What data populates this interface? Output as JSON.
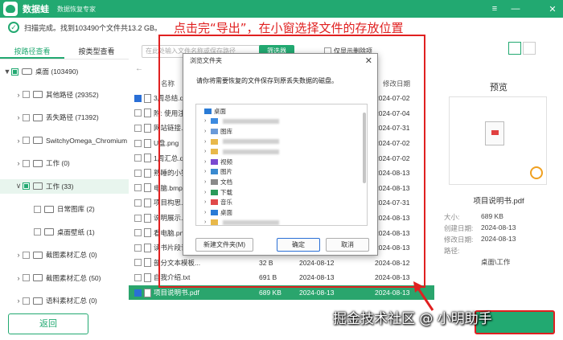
{
  "app": {
    "name": "数据蛙",
    "subtitle": "数据恢复专家"
  },
  "status": {
    "text": "扫描完成。找到103490个文件共13.2 GB。"
  },
  "annotation": {
    "instruction": "点击完“导出”，在小窗选择文件的存放位置",
    "watermark": "掘金技术社区 @ 小明助手"
  },
  "sidebar": {
    "tabs": [
      {
        "label": "按路径查看",
        "active": true
      },
      {
        "label": "按类型查看",
        "active": false
      }
    ],
    "tree": [
      {
        "label": "桌面 (103490)",
        "indent": 0,
        "arrow": "▼",
        "state": "part",
        "icon": "drive"
      },
      {
        "label": "其他路径 (29352)",
        "indent": 1,
        "arrow": "›",
        "state": "",
        "icon": "folder"
      },
      {
        "label": "丢失路径 (71392)",
        "indent": 1,
        "arrow": "›",
        "state": "",
        "icon": "folder"
      },
      {
        "label": "SwitchyOmega_Chromium",
        "indent": 1,
        "arrow": "›",
        "state": "",
        "icon": "folder"
      },
      {
        "label": "工作 (0)",
        "indent": 1,
        "arrow": "›",
        "state": "",
        "icon": "folder"
      },
      {
        "label": "工作 (33)",
        "indent": 1,
        "arrow": "∨",
        "state": "part",
        "icon": "folder",
        "selected": true
      },
      {
        "label": "日常图库 (2)",
        "indent": 2,
        "arrow": "",
        "state": "",
        "icon": "folder"
      },
      {
        "label": "桌面壁纸 (1)",
        "indent": 2,
        "arrow": "",
        "state": "",
        "icon": "folder"
      },
      {
        "label": "截图素材汇总 (0)",
        "indent": 1,
        "arrow": "›",
        "state": "",
        "icon": "folder"
      },
      {
        "label": "截图素材汇总 (50)",
        "indent": 1,
        "arrow": "›",
        "state": "",
        "icon": "folder"
      },
      {
        "label": "语料素材汇总 (0)",
        "indent": 1,
        "arrow": "›",
        "state": "",
        "icon": "folder"
      }
    ],
    "back_label": "返回"
  },
  "toolbar": {
    "search_placeholder": "在此处输入文件名称或保存路径",
    "filter_label": "筛选器",
    "only_deleted_label": "仅显示删除项"
  },
  "files": {
    "headers": {
      "name": "名称",
      "date": "修改日期"
    },
    "rows": [
      {
        "name": "3周总结.do",
        "size": "",
        "extra": "",
        "date": "2024-07-02",
        "checked": true
      },
      {
        "name": "附: 使用注",
        "size": "",
        "extra": "",
        "date": "2024-07-04",
        "checked": false
      },
      {
        "name": "网站链接.tx",
        "size": "",
        "extra": "",
        "date": "2024-07-31",
        "checked": false
      },
      {
        "name": "U盘.png",
        "size": "",
        "extra": "",
        "date": "2024-07-02",
        "checked": false
      },
      {
        "name": "1周汇总.do",
        "size": "",
        "extra": "",
        "date": "2024-07-02",
        "checked": false
      },
      {
        "name": "熟睡的小猫",
        "size": "",
        "extra": "",
        "date": "2024-08-13",
        "checked": false
      },
      {
        "name": "电脑.bmp",
        "size": "",
        "extra": "",
        "date": "2024-08-13",
        "checked": false
      },
      {
        "name": "项目构思.d",
        "size": "",
        "extra": "",
        "date": "2024-07-31",
        "checked": false
      },
      {
        "name": "说明展示.p",
        "size": "",
        "extra": "",
        "date": "2024-08-13",
        "checked": false
      },
      {
        "name": "看电脑.png",
        "size": "",
        "extra": "",
        "date": "2024-08-13",
        "checked": false
      },
      {
        "name": "读书片段记",
        "size": "",
        "extra": "",
        "date": "2024-08-13",
        "checked": false
      },
      {
        "name": "部分文本模板...",
        "size": "32 B",
        "extra": "2024-08-12",
        "date": "2024-08-12",
        "checked": false
      },
      {
        "name": "自我介绍.txt",
        "size": "691 B",
        "extra": "2024-08-13",
        "date": "2024-08-13",
        "checked": false
      },
      {
        "name": "项目说明书.pdf",
        "size": "689 KB",
        "extra": "2024-08-13",
        "date": "2024-08-13",
        "checked": true,
        "selected": true
      }
    ]
  },
  "preview": {
    "title": "预览",
    "filename": "项目说明书.pdf",
    "meta": [
      {
        "label": "大小:",
        "value": "689 KB"
      },
      {
        "label": "创建日期:",
        "value": "2024-08-13"
      },
      {
        "label": "修改日期:",
        "value": "2024-08-13"
      },
      {
        "label": "路径:",
        "value": ""
      },
      {
        "label": "",
        "value": "桌面\\工作"
      }
    ]
  },
  "dialog": {
    "title": "浏览文件夹",
    "message": "请你将需要恢复的文件保存到原丢失数据的磁盘。",
    "tree": [
      {
        "label": "桌面",
        "indent": 0,
        "arrow": "",
        "icon": "#2a7bd6"
      },
      {
        "label": "",
        "indent": 1,
        "arrow": "›",
        "icon": "#3c8ae0",
        "blur": true
      },
      {
        "label": "图库",
        "indent": 1,
        "arrow": "›",
        "icon": "#6a9ad9"
      },
      {
        "label": "",
        "indent": 1,
        "arrow": "›",
        "icon": "#e8b84a",
        "blur": true
      },
      {
        "label": "",
        "indent": 1,
        "arrow": "›",
        "icon": "#e8b84a",
        "blur": true
      },
      {
        "label": "视频",
        "indent": 1,
        "arrow": "›",
        "icon": "#7a4ad0"
      },
      {
        "label": "图片",
        "indent": 1,
        "arrow": "›",
        "icon": "#3a8ad0"
      },
      {
        "label": "文档",
        "indent": 1,
        "arrow": "›",
        "icon": "#8a8a8a"
      },
      {
        "label": "下载",
        "indent": 1,
        "arrow": "›",
        "icon": "#2a9a5a"
      },
      {
        "label": "音乐",
        "indent": 1,
        "arrow": "›",
        "icon": "#e04a4a"
      },
      {
        "label": "桌面",
        "indent": 1,
        "arrow": "›",
        "icon": "#2a7bd6"
      },
      {
        "label": "",
        "indent": 1,
        "arrow": "›",
        "icon": "#e8b84a",
        "blur": true
      },
      {
        "label": "此电脑",
        "indent": 0,
        "arrow": "›",
        "icon": "#4a7ab0"
      },
      {
        "label": "库",
        "indent": 0,
        "arrow": "›",
        "icon": "#e8b84a"
      }
    ],
    "new_folder_label": "新建文件夹(M)",
    "ok_label": "确定",
    "cancel_label": "取消"
  }
}
